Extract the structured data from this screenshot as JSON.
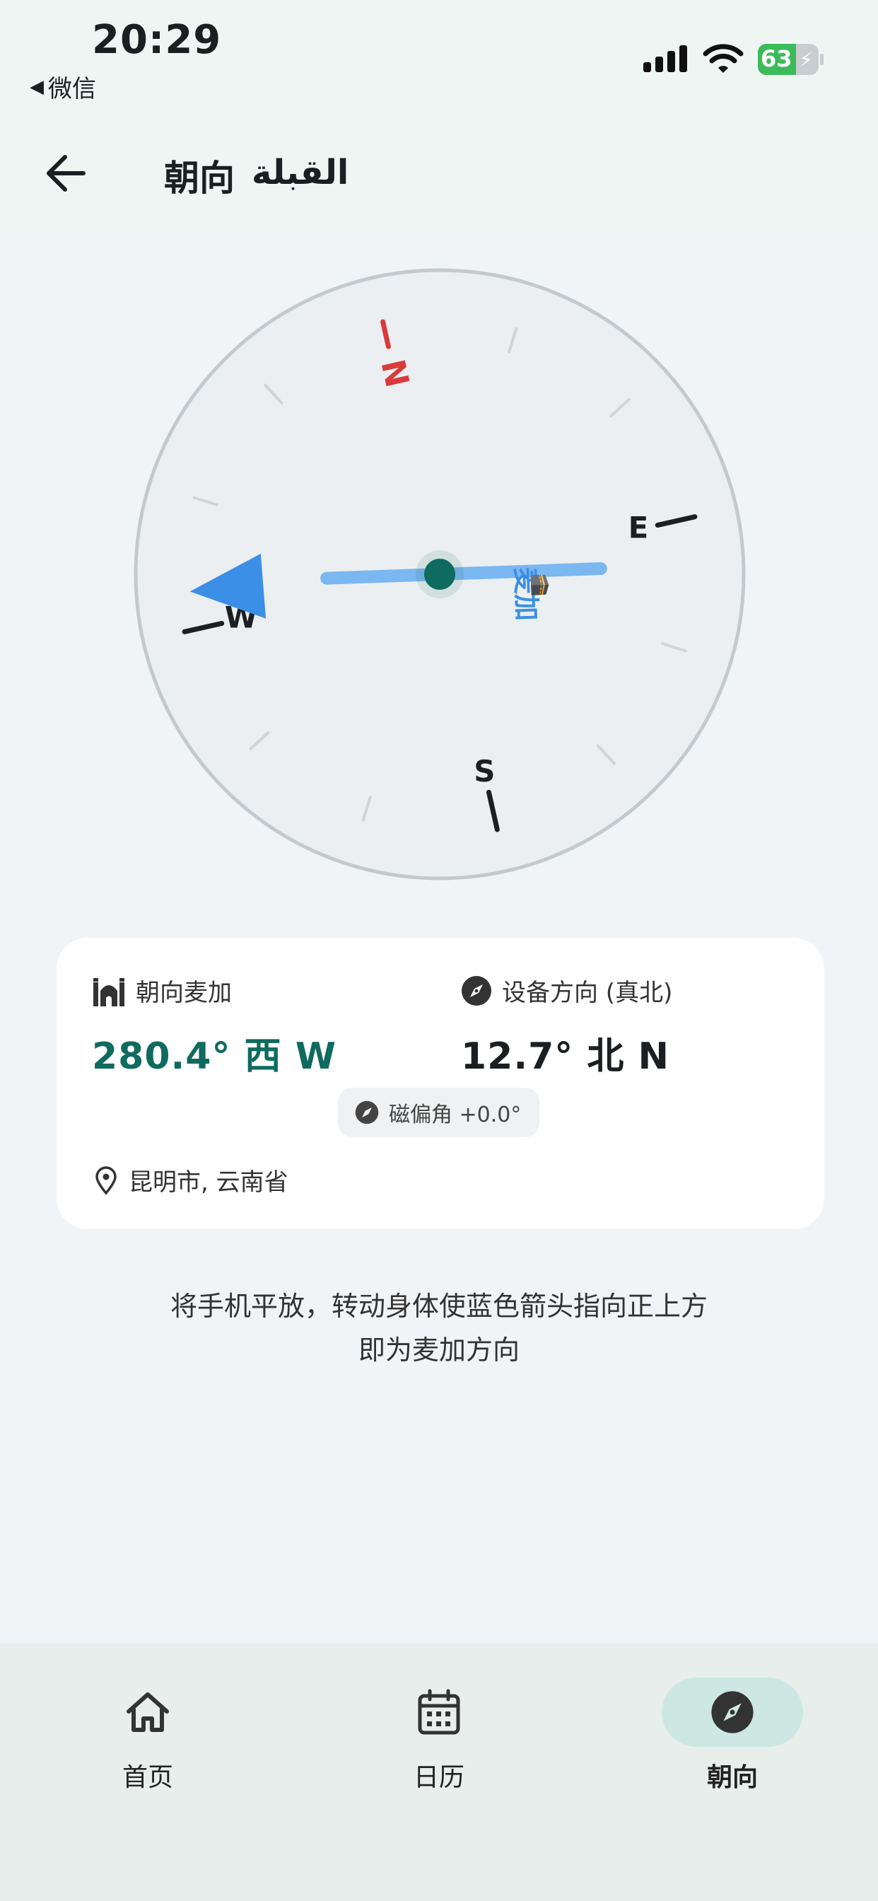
{
  "status_bar": {
    "time": "20:29",
    "back_app": "微信",
    "battery": "63"
  },
  "app_bar": {
    "title": "朝向",
    "title_arabic": "القبلة"
  },
  "compass": {
    "directions": [
      "N",
      "E",
      "S",
      "W"
    ],
    "needle_label": "麦加",
    "colors": {
      "north": "#d93a3a",
      "needle": "#3b8fe6",
      "needle_bar": "#7bb7f0",
      "hub": "#0f6b5f"
    }
  },
  "info": {
    "qibla_label": "朝向麦加",
    "qibla_value": "280.4° 西 W",
    "device_label": "设备方向 (真北)",
    "device_value": "12.7° 北 N",
    "declination": "磁偏角 +0.0°",
    "location": "昆明市, 云南省"
  },
  "hint": {
    "line1": "将手机平放，转动身体使蓝色箭头指向正上方",
    "line2": "即为麦加方向"
  },
  "nav": {
    "home": "首页",
    "calendar": "日历",
    "qibla": "朝向"
  }
}
